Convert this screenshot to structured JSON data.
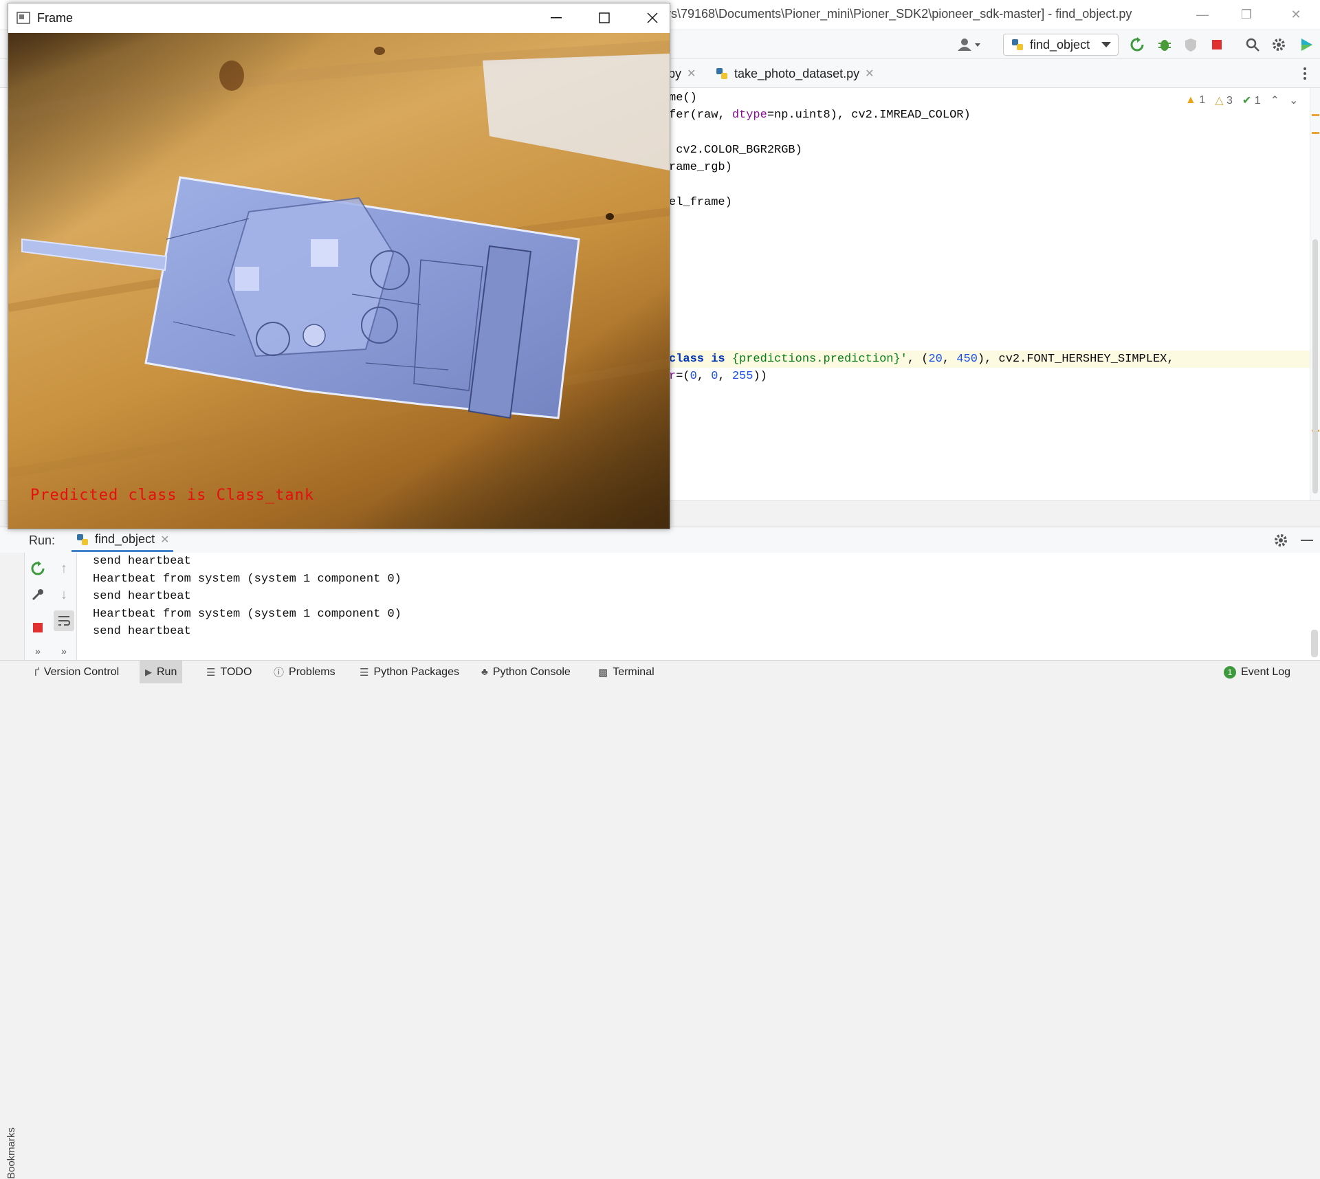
{
  "ide": {
    "title": "rs\\79168\\Documents\\Pioner_mini\\Pioner_SDK2\\pioneer_sdk-master] - find_object.py",
    "run_config": "find_object",
    "tabs": [
      {
        "label": "py"
      },
      {
        "label": "take_photo_dataset.py"
      }
    ],
    "inspections": {
      "errors": "1",
      "warnings": "3",
      "ok": "1"
    },
    "code_lines": [
      {
        "text": "me()"
      },
      {
        "text": "fer(raw, dtype=np.uint8), cv2.IMREAD_COLOR)"
      },
      {
        "text": ""
      },
      {
        "text": " cv2.COLOR_BGR2RGB)"
      },
      {
        "text": "rame_rgb)"
      },
      {
        "text": ""
      },
      {
        "text": "el_frame)"
      },
      {
        "text": "class is {predictions.prediction}', (20, 450), cv2.FONT_HERSHEY_SIMPLEX,"
      },
      {
        "text": "r=(0, 0, 255))"
      }
    ]
  },
  "run": {
    "label": "Run:",
    "tab": "find_object",
    "console": [
      "send heartbeat",
      "Heartbeat from system (system 1 component 0)",
      "send heartbeat",
      "Heartbeat from system (system 1 component 0)",
      "send heartbeat"
    ],
    "bookmarks_label": "Bookmarks"
  },
  "bottom_bar": {
    "items": [
      "Version Control",
      "Run",
      "TODO",
      "Problems",
      "Python Packages",
      "Python Console",
      "Terminal"
    ],
    "event_log": "Event Log",
    "event_count": "1"
  },
  "frame_window": {
    "title": "Frame",
    "overlay_text": "Predicted class is Class_tank"
  },
  "colors": {
    "prediction_text": "#e50f0f",
    "accent": "#4083c9",
    "run_green": "#3c9a3c",
    "stop_red": "#e03030"
  }
}
